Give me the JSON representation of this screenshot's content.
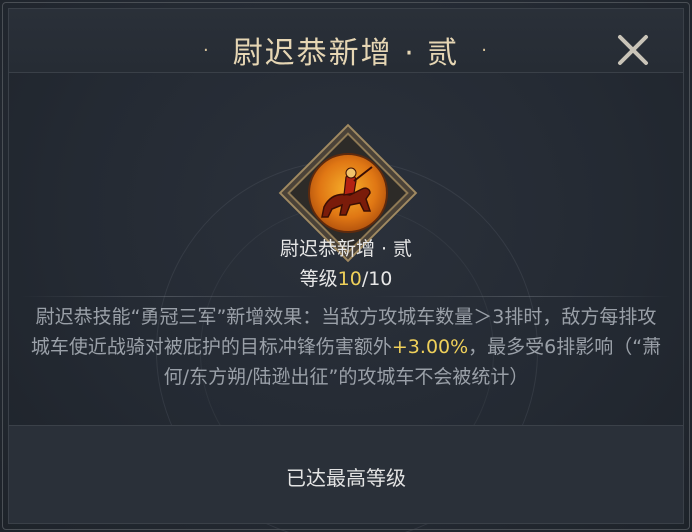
{
  "dialog": {
    "title": "尉迟恭新增 · 贰",
    "title_dot_left": "·",
    "title_dot_right": "·"
  },
  "skill": {
    "name": "尉迟恭新增 · 贰",
    "level_prefix": "等级",
    "level_current": "10",
    "level_max": "/10",
    "icon": "cavalry-rider-icon"
  },
  "description": {
    "part1": "尉迟恭技能“勇冠三军”新增效果：当敌方攻城车数量＞3排时，敌方每排攻城车使近战骑对被庇护的目标冲锋伤害额外",
    "highlight": "+3.00%",
    "part2": "，最多受6排影响（“萧何/东方朔/陆逊出征”的攻城车不会被统计）"
  },
  "footer": {
    "status": "已达最高等级"
  },
  "colors": {
    "title": "#e6d6b4",
    "highlight": "#efd05a",
    "body_text": "#9aa0a8",
    "background": "#242a33"
  }
}
